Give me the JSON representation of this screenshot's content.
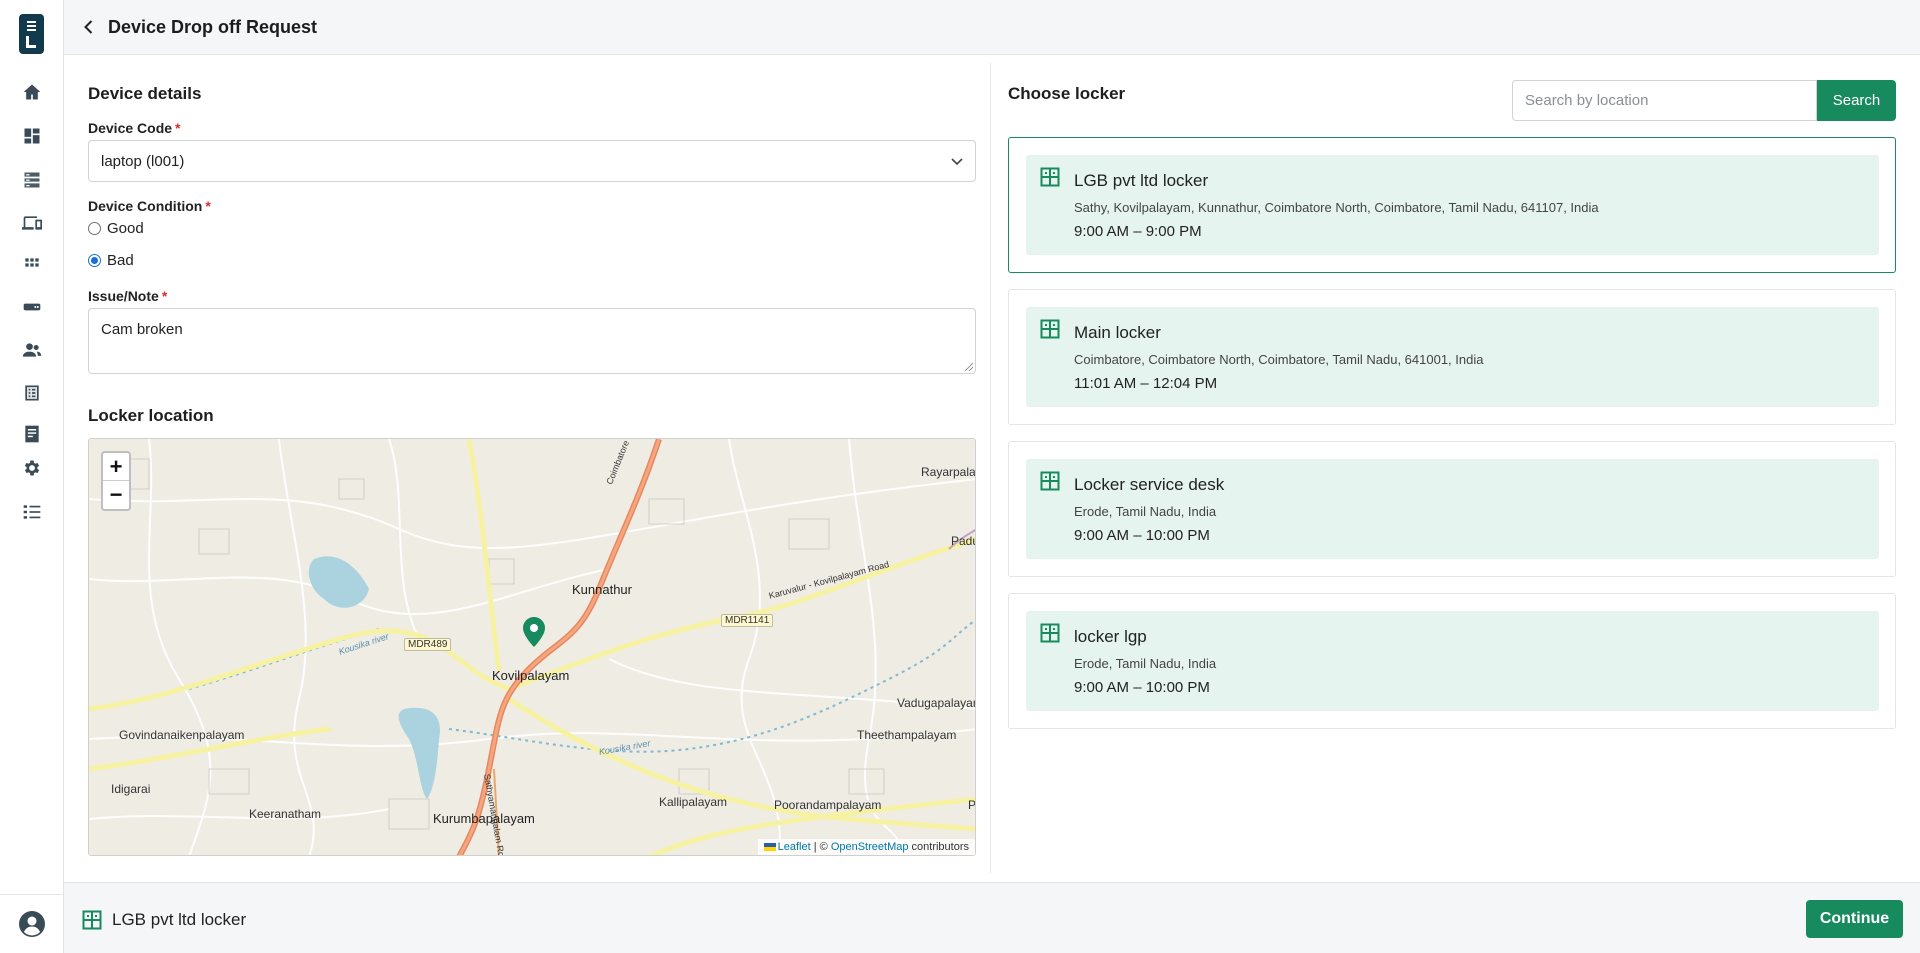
{
  "header": {
    "title": "Device Drop off Request"
  },
  "device_details": {
    "title": "Device details",
    "device_code": {
      "label": "Device Code",
      "required_mark": "*",
      "value": "laptop (l001)"
    },
    "device_condition": {
      "label": "Device Condition",
      "required_mark": "*",
      "options": [
        {
          "label": "Good",
          "checked": false
        },
        {
          "label": "Bad",
          "checked": true
        }
      ]
    },
    "issue_note": {
      "label": "Issue/Note",
      "required_mark": "*",
      "value": "Cam broken"
    }
  },
  "locker_location": {
    "title": "Locker location",
    "map": {
      "zoom_in": "+",
      "zoom_out": "−",
      "place_labels": [
        "Rayarpala",
        "Padu",
        "Kunnathur",
        "Kovilpalayam",
        "Govindanaikenpalayam",
        "Vadugapalayar",
        "Theethampalayam",
        "Idigarai",
        "Keeranatham",
        "Kurumbapalayam",
        "Kallipalayam",
        "Poorandampalayam",
        "P"
      ],
      "road_labels": [
        "MDR489",
        "MDR1141",
        "Karuvalur - Kovilpalayam Road",
        "Coimbatore - Sathyamangalam",
        "Sathyamangalam Road",
        "Kousika river",
        "Kousika river"
      ],
      "attribution": {
        "leaflet": "Leaflet",
        "separator": " | © ",
        "osm": "OpenStreetMap",
        "suffix": " contributors"
      }
    }
  },
  "choose_locker": {
    "title": "Choose locker",
    "search": {
      "placeholder": "Search by location",
      "button_label": "Search"
    },
    "lockers": [
      {
        "name": "LGB pvt ltd locker",
        "address": "Sathy, Kovilpalayam, Kunnathur, Coimbatore North, Coimbatore, Tamil Nadu, 641107, India",
        "hours": "9:00 AM – 9:00 PM",
        "selected": true
      },
      {
        "name": "Main locker",
        "address": "Coimbatore, Coimbatore North, Coimbatore, Tamil Nadu, 641001, India",
        "hours": "11:01 AM – 12:04 PM",
        "selected": false
      },
      {
        "name": "Locker service desk",
        "address": "Erode, Tamil Nadu, India",
        "hours": "9:00 AM – 10:00 PM",
        "selected": false
      },
      {
        "name": "locker lgp",
        "address": "Erode, Tamil Nadu, India",
        "hours": "9:00 AM – 10:00 PM",
        "selected": false
      }
    ]
  },
  "footer": {
    "selected_locker": "LGB pvt ltd locker",
    "continue_label": "Continue"
  },
  "sidebar": {
    "icons": [
      "home-icon",
      "dashboard-icon",
      "storage-icon",
      "devices-icon",
      "apps-icon",
      "device-card-icon",
      "users-icon",
      "list-icon",
      "document-icon",
      "gear-icon",
      "checklist-icon"
    ]
  },
  "colors": {
    "accent": "#178a5e",
    "locker_bg": "#e5f4ee",
    "logo": "#123a4d"
  }
}
